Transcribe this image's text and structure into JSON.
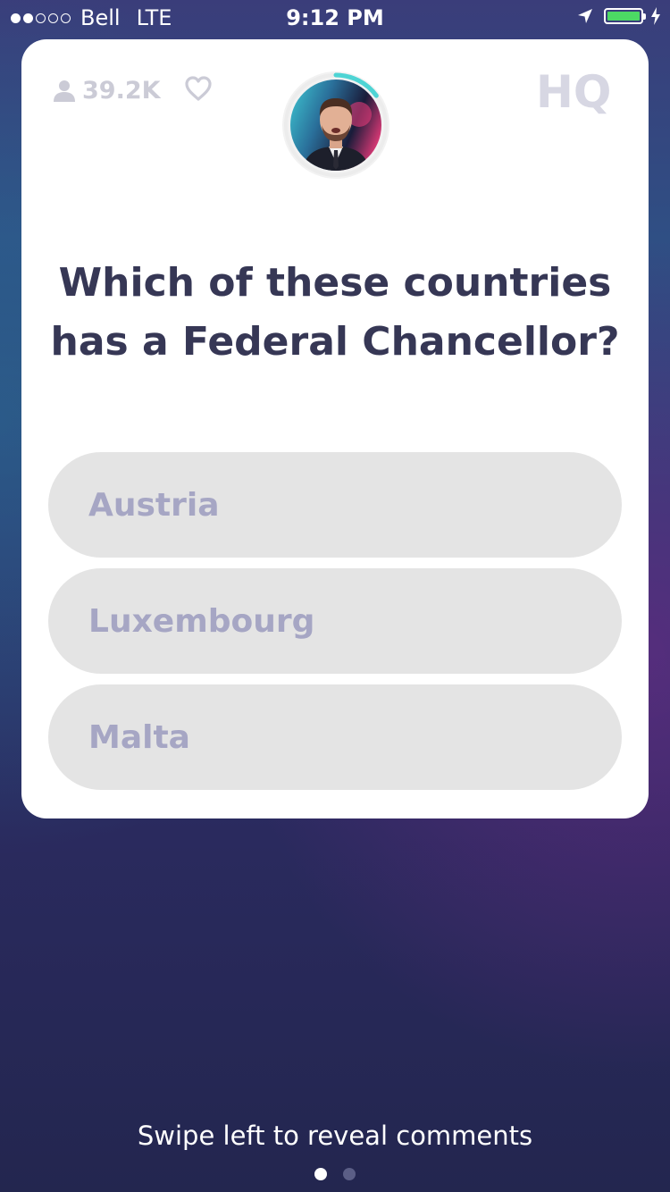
{
  "status_bar": {
    "carrier": "Bell",
    "network": "LTE",
    "time": "9:12 PM",
    "signal_bars_filled": 2,
    "signal_bars_total": 5,
    "battery_fraction": 1.0,
    "battery_color": "#4cd964"
  },
  "card": {
    "viewer_count": "39.2K",
    "logo": "HQ",
    "heart_icon": "heart-outline-icon",
    "question": "Which of these countries has a Federal Chancellor?",
    "answers": [
      {
        "label": "Austria"
      },
      {
        "label": "Luxembourg"
      },
      {
        "label": "Malta"
      }
    ],
    "timer_fraction_remaining": 0.15
  },
  "footer": {
    "swipe_hint": "Swipe left to reveal comments",
    "pages_total": 2,
    "active_page": 1
  },
  "colors": {
    "question_text": "#363755",
    "answer_bg": "#e4e4e4",
    "answer_text": "#a6a6c4",
    "timer_accent": "#4ed4d4"
  }
}
